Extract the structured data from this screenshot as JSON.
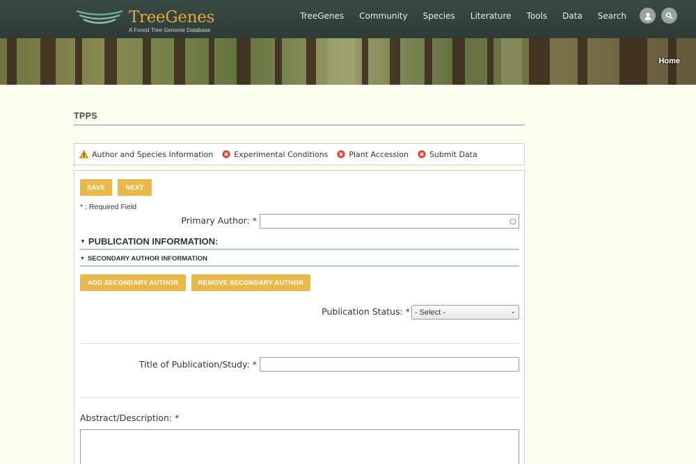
{
  "header": {
    "logo_title": "TreeGenes",
    "logo_subtitle": "A Forest Tree Genome Database",
    "nav": [
      "TreeGenes",
      "Community",
      "Species",
      "Literature",
      "Tools",
      "Data",
      "Search"
    ],
    "breadcrumb": "Home"
  },
  "page": {
    "title": "TPPS"
  },
  "steps": [
    {
      "label": "Author and Species Information",
      "status": "warning"
    },
    {
      "label": "Experimental Conditions",
      "status": "error"
    },
    {
      "label": "Plant Accession",
      "status": "error"
    },
    {
      "label": "Submit Data",
      "status": "error"
    }
  ],
  "form": {
    "save_label": "Save",
    "next_label": "Next",
    "required_note": "* : Required Field",
    "primary_author_label": "Primary Author: *",
    "primary_author_value": "",
    "publication_section": "Publication Information:",
    "secondary_author_section": "Secondary Author Information",
    "add_secondary_label": "Add Secondary Author",
    "remove_secondary_label": "Remove Secondary Author",
    "publication_status_label": "Publication Status: *",
    "publication_status_value": "- Select -",
    "title_label": "Title of Publication/Study: *",
    "title_value": "",
    "abstract_label": "Abstract/Description: *"
  },
  "colors": {
    "accent": "#e9b84b",
    "rule": "#a9ccc3",
    "header_bg": "#2e3b36",
    "page_bg": "#fbfdee",
    "logo_gold": "#e2a93b",
    "error": "#d9453b",
    "warning": "#f0b400"
  }
}
